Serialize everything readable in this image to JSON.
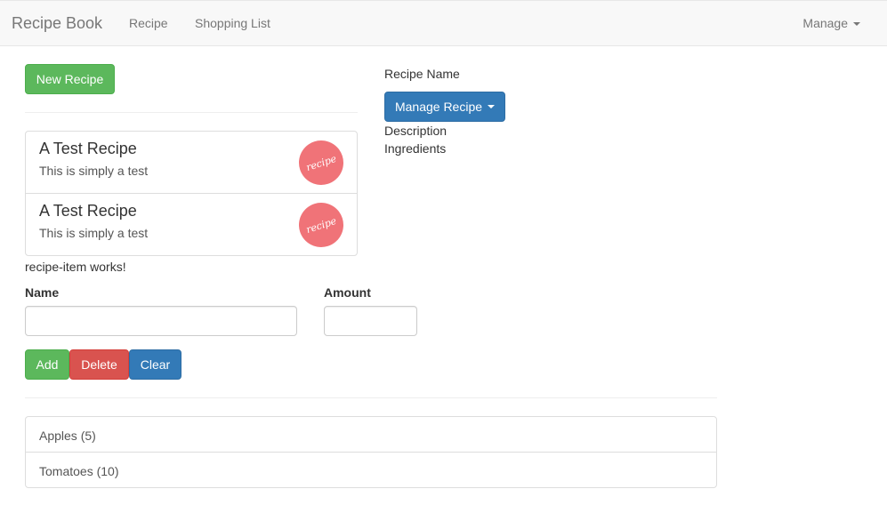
{
  "navbar": {
    "brand": "Recipe Book",
    "links": [
      "Recipe",
      "Shopping List"
    ],
    "manage": "Manage"
  },
  "recipes": {
    "new_button": "New Recipe",
    "items": [
      {
        "name": "A Test Recipe",
        "description": "This is simply a test",
        "image_text": "recipe"
      },
      {
        "name": "A Test Recipe",
        "description": "This is simply a test",
        "image_text": "recipe"
      }
    ],
    "item_status": "recipe-item works!"
  },
  "detail": {
    "name": "Recipe Name",
    "manage_button": "Manage Recipe",
    "description": "Description",
    "ingredients": "Ingredients"
  },
  "shopping_form": {
    "name_label": "Name",
    "amount_label": "Amount",
    "name_value": "",
    "amount_value": "",
    "add_label": "Add",
    "delete_label": "Delete",
    "clear_label": "Clear"
  },
  "shopping_list": [
    "Apples (5)",
    "Tomatoes (10)"
  ],
  "colors": {
    "success": "#5cb85c",
    "danger": "#d9534f",
    "primary": "#337ab7",
    "recipe_image": "#f07378"
  }
}
